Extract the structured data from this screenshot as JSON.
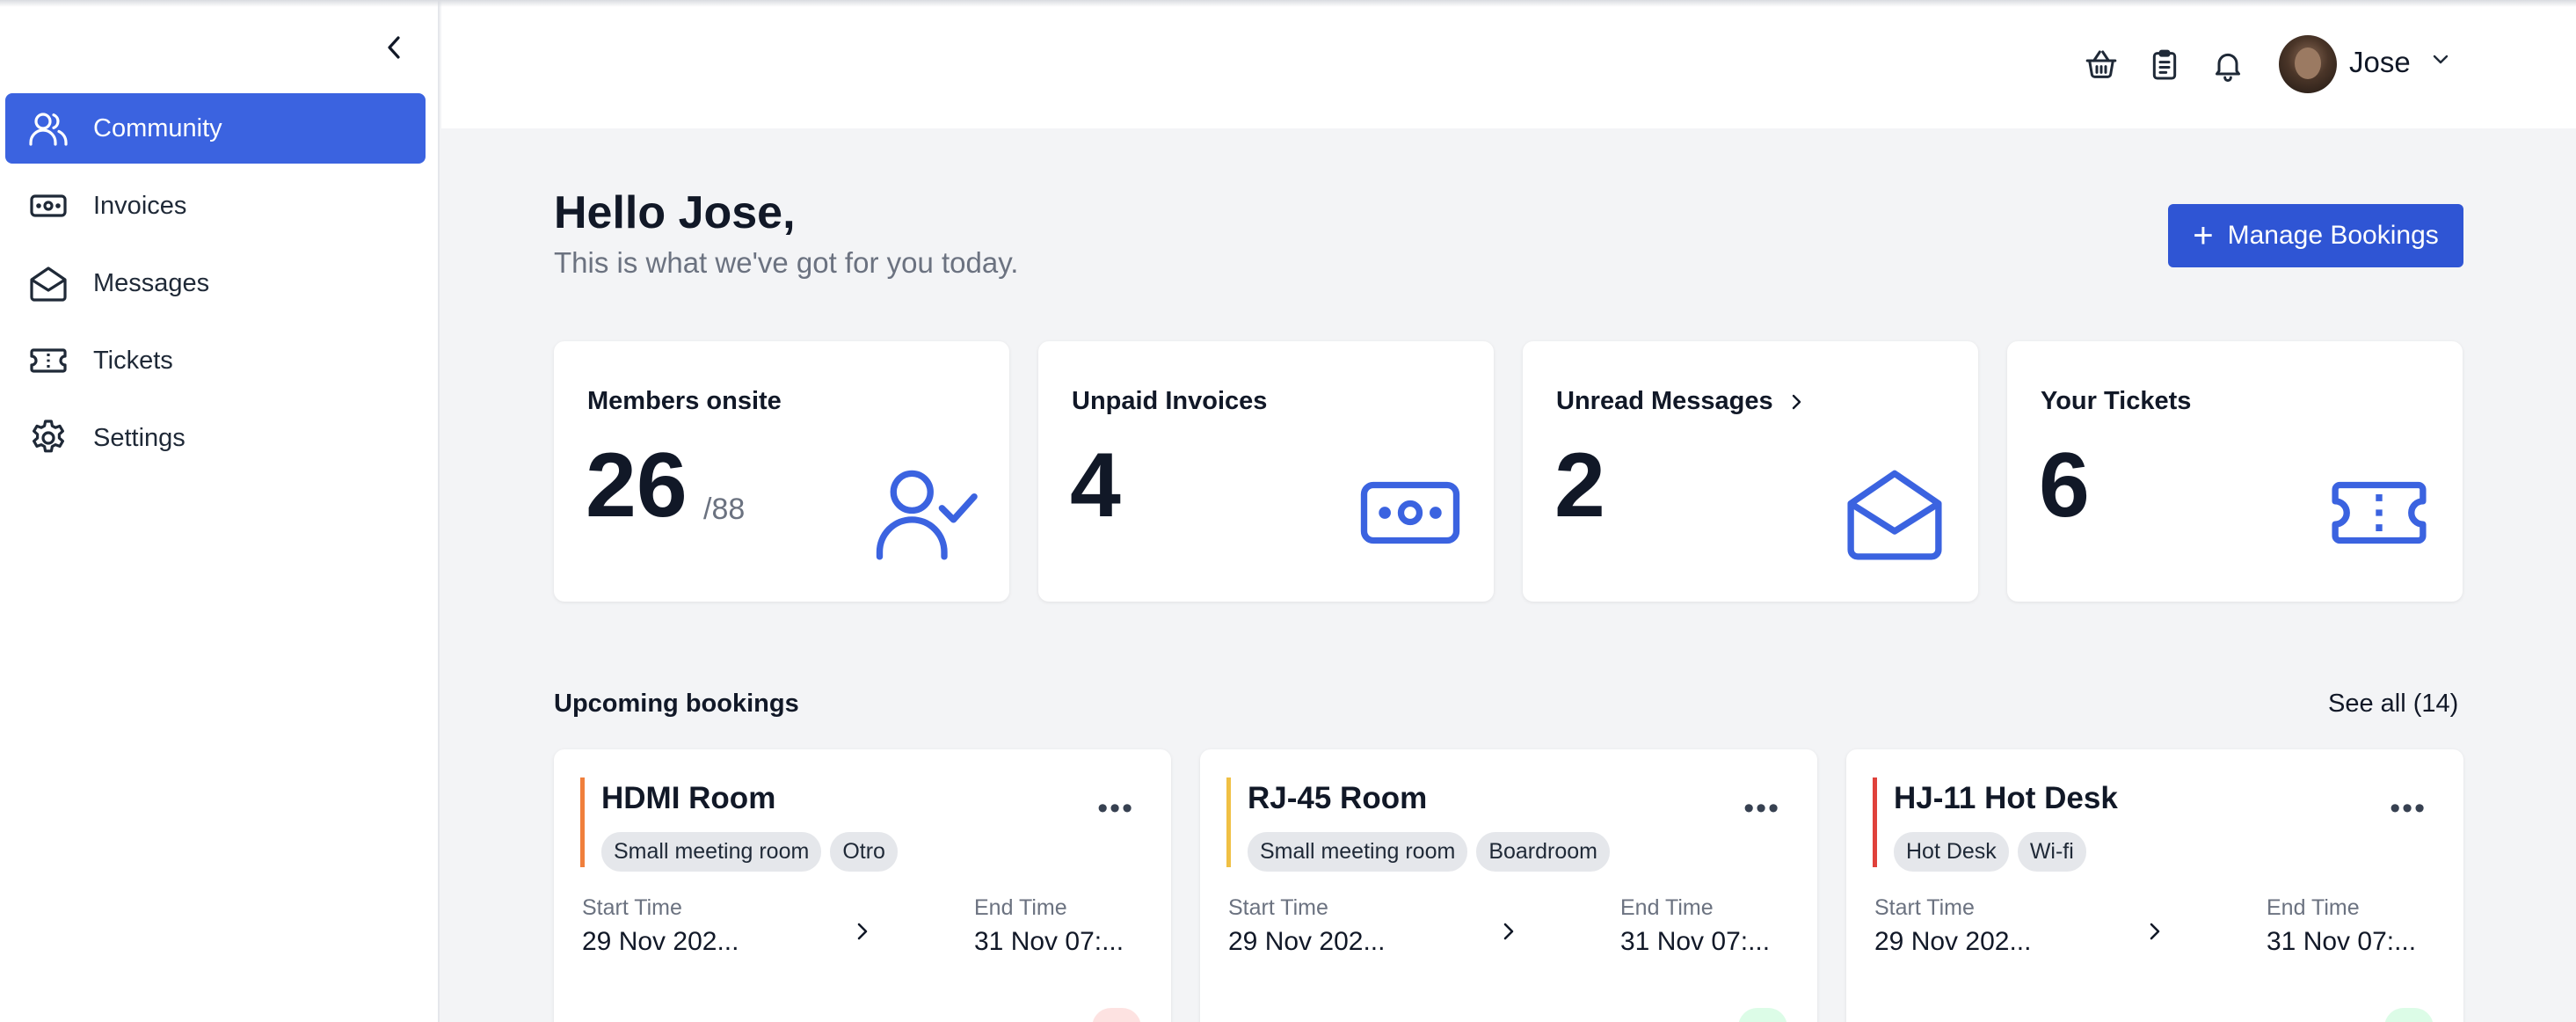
{
  "sidebar": {
    "items": [
      {
        "label": "Community",
        "icon": "users-icon",
        "active": true
      },
      {
        "label": "Invoices",
        "icon": "banknote-icon"
      },
      {
        "label": "Messages",
        "icon": "envelope-icon"
      },
      {
        "label": "Tickets",
        "icon": "ticket-icon"
      },
      {
        "label": "Settings",
        "icon": "gear-icon"
      }
    ]
  },
  "header": {
    "user_name": "Jose"
  },
  "greeting": {
    "title": "Hello Jose,",
    "subtitle": "This is what we've got for you today."
  },
  "actions": {
    "manage_bookings_label": "Manage Bookings"
  },
  "stats": [
    {
      "label": "Members onsite",
      "value": "26",
      "total": "/88",
      "icon": "user-check-icon"
    },
    {
      "label": "Unpaid Invoices",
      "value": "4",
      "icon": "banknote-icon"
    },
    {
      "label": "Unread Messages",
      "value": "2",
      "icon": "envelope-open-icon"
    },
    {
      "label": "Your Tickets",
      "value": "6",
      "icon": "ticket-icon"
    }
  ],
  "bookings": {
    "title": "Upcoming bookings",
    "see_all": "See all (14)",
    "items": [
      {
        "name": "HDMI Room",
        "accent": "#f07f3c",
        "tags": [
          "Small meeting room",
          "Otro"
        ],
        "start_label": "Start Time",
        "start": "29 Nov 202...",
        "end_label": "End Time",
        "end": "31 Nov 07:..."
      },
      {
        "name": "RJ-45 Room",
        "accent": "#f0c044",
        "tags": [
          "Small meeting room",
          "Boardroom"
        ],
        "start_label": "Start Time",
        "start": "29 Nov 202...",
        "end_label": "End Time",
        "end": "31 Nov 07:..."
      },
      {
        "name": "HJ-11 Hot Desk",
        "accent": "#e0413b",
        "tags": [
          "Hot Desk",
          "Wi-fi"
        ],
        "start_label": "Start Time",
        "start": "29 Nov 202...",
        "end_label": "End Time",
        "end": "31 Nov 07:..."
      }
    ]
  },
  "colors": {
    "primary": "#3b63e0",
    "button": "#2f55d4",
    "pending_bg": "#fde2e1",
    "confirmed_bg": "#dcfce7"
  }
}
